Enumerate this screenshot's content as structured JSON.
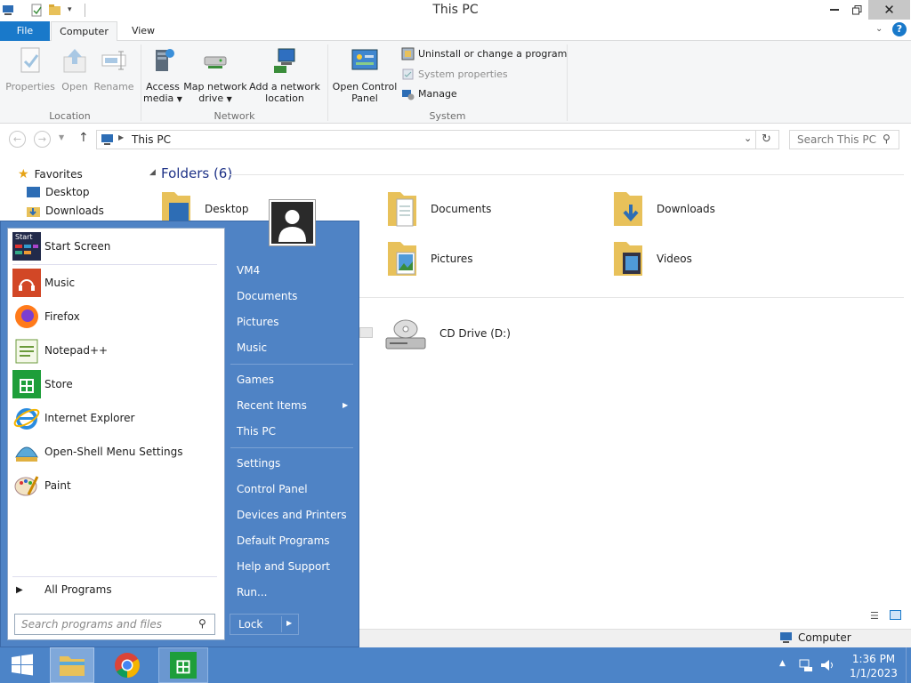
{
  "window": {
    "title": "This PC"
  },
  "ribbon": {
    "tabs": {
      "file": "File",
      "computer": "Computer",
      "view": "View"
    },
    "location": {
      "properties": "Properties",
      "open": "Open",
      "rename": "Rename",
      "group": "Location"
    },
    "network": {
      "access_media_1": "Access",
      "access_media_2": "media",
      "map_drive_1": "Map network",
      "map_drive_2": "drive",
      "add_loc_1": "Add a network",
      "add_loc_2": "location",
      "group": "Network"
    },
    "system": {
      "ocp_1": "Open Control",
      "ocp_2": "Panel",
      "uninstall": "Uninstall or change a program",
      "sysprops": "System properties",
      "manage": "Manage",
      "group": "System"
    }
  },
  "address": {
    "path": "This PC",
    "search_placeholder": "Search This PC"
  },
  "nav": {
    "favorites": "Favorites",
    "desktop": "Desktop",
    "downloads": "Downloads"
  },
  "content": {
    "folders_header": "Folders (6)",
    "folders": [
      "Desktop",
      "Documents",
      "Downloads",
      "Pictures",
      "Videos"
    ],
    "drive": "CD Drive (D:)"
  },
  "start_menu": {
    "programs": [
      "Start Screen",
      "Music",
      "Firefox",
      "Notepad++",
      "Store",
      "Internet Explorer",
      "Open-Shell Menu Settings",
      "Paint"
    ],
    "start_icon_text": "Start",
    "all_programs": "All Programs",
    "search_placeholder": "Search programs and files",
    "right": [
      "VM4",
      "Documents",
      "Pictures",
      "Music",
      "Games",
      "Recent Items",
      "This PC",
      "Settings",
      "Control Panel",
      "Devices and Printers",
      "Default Programs",
      "Help and Support",
      "Run..."
    ],
    "lock": "Lock"
  },
  "statusbar": {
    "computer": "Computer"
  },
  "taskbar": {
    "time": "1:36 PM",
    "date": "1/1/2023"
  },
  "colors": {
    "accent": "#1979ca",
    "start_menu": "#4f83c5",
    "taskbar": "#4c84c8"
  }
}
